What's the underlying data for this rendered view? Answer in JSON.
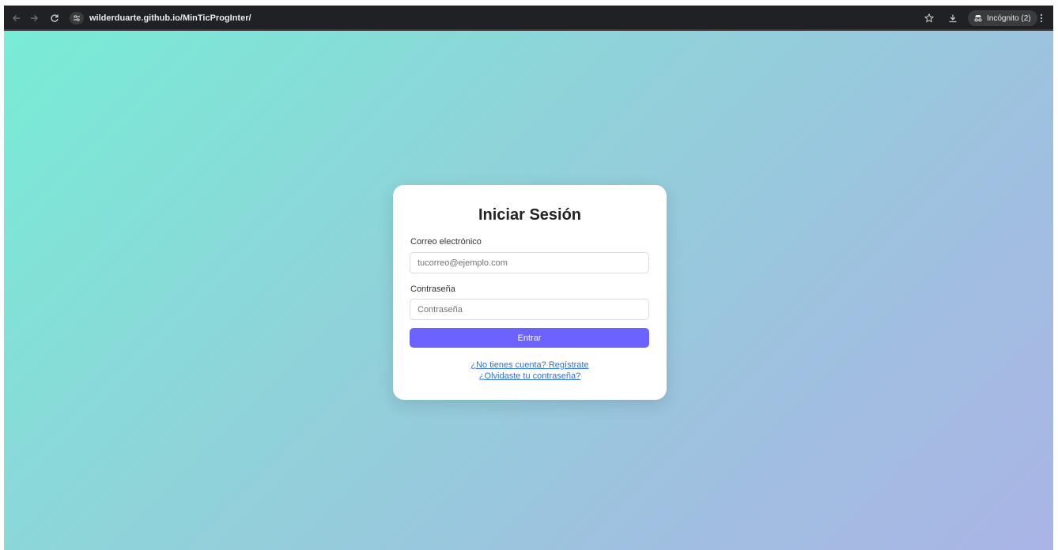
{
  "browser": {
    "url": "wilderduarte.github.io/MinTicProgInter/",
    "incognito_label": "Incógnito (2)",
    "icons": {
      "back": "arrow-left-icon",
      "forward": "arrow-right-icon",
      "reload": "reload-icon",
      "site_info": "tune-icon",
      "bookmark": "star-icon",
      "download": "download-icon",
      "incognito": "incognito-icon",
      "menu": "kebab-menu-icon"
    }
  },
  "login": {
    "title": "Iniciar Sesión",
    "email_label": "Correo electrónico",
    "email_placeholder": "tucorreo@ejemplo.com",
    "email_value": "",
    "password_label": "Contraseña",
    "password_placeholder": "Contraseña",
    "password_value": "",
    "submit_label": "Entrar",
    "register_link": "¿No tienes cuenta? Regístrate",
    "forgot_link": "¿Olvidaste tu contraseña?"
  },
  "colors": {
    "accent": "#6c63ff",
    "link": "#2f6fe4",
    "gradient_start": "#78ecd6",
    "gradient_end": "#aab4e6",
    "toolbar": "#202124"
  }
}
